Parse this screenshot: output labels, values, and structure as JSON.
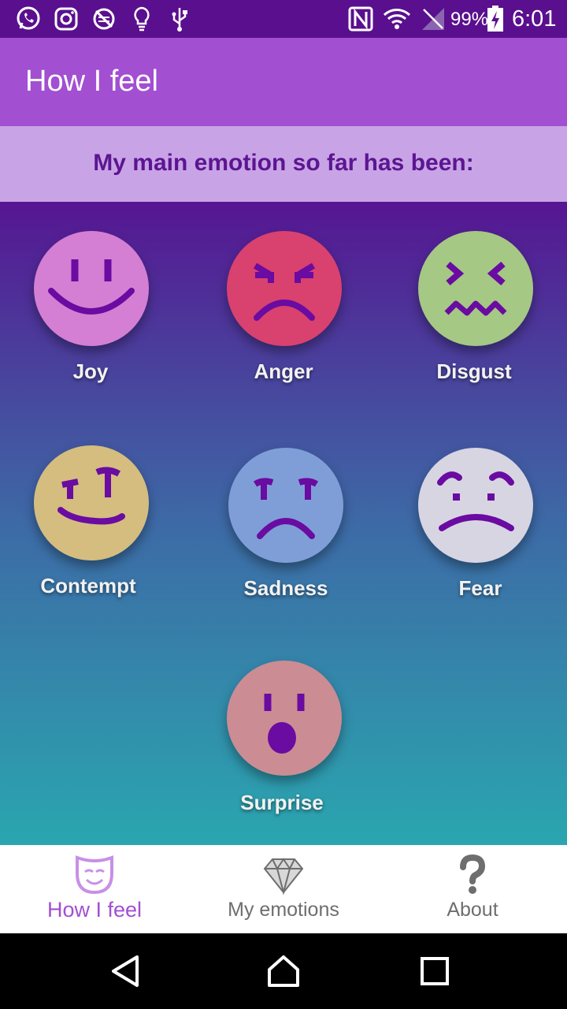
{
  "status_bar": {
    "battery_percent": "99%",
    "time": "6:01",
    "icons": [
      "whatsapp-icon",
      "instagram-icon",
      "no-sync-icon",
      "lightbulb-icon",
      "usb-icon",
      "nfc-icon",
      "wifi-icon",
      "no-signal-icon",
      "battery-charging-icon"
    ]
  },
  "app_bar": {
    "title": "How I feel"
  },
  "banner": {
    "text": "My main emotion so far has been:"
  },
  "emotions": [
    {
      "label": "Joy",
      "color": "#d47fd3"
    },
    {
      "label": "Anger",
      "color": "#d9416f"
    },
    {
      "label": "Disgust",
      "color": "#a5c884"
    },
    {
      "label": "Contempt",
      "color": "#d4bd7f"
    },
    {
      "label": "Sadness",
      "color": "#7f9ed8"
    },
    {
      "label": "Fear",
      "color": "#d7d5e2"
    },
    {
      "label": "Surprise",
      "color": "#cc8c94"
    }
  ],
  "face_feature_color": "#6a0ba1",
  "bottom_nav": {
    "items": [
      {
        "label": "How I feel",
        "icon": "mask-icon",
        "active": true
      },
      {
        "label": "My emotions",
        "icon": "diamond-icon",
        "active": false
      },
      {
        "label": "About",
        "icon": "question-icon",
        "active": false
      }
    ],
    "active_color": "#a24fd1"
  },
  "system_nav": {
    "icons": [
      "back-icon",
      "home-icon",
      "recents-icon"
    ]
  }
}
